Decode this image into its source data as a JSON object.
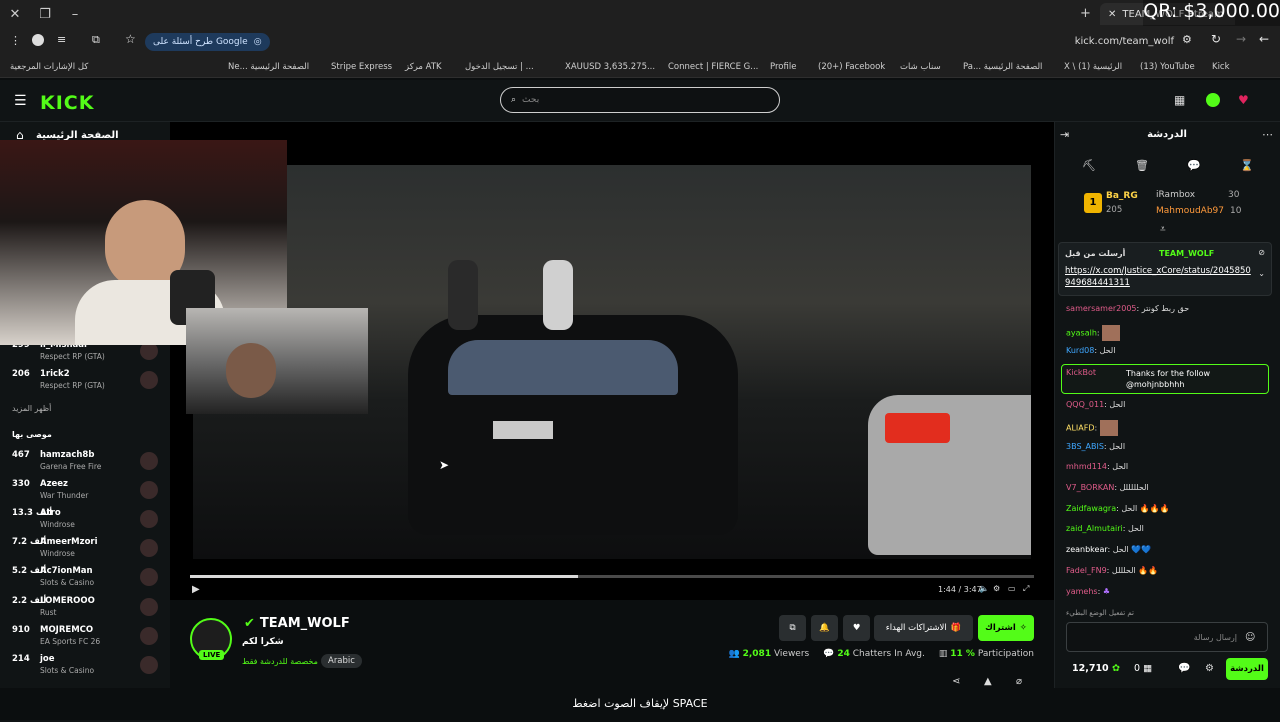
{
  "browser": {
    "tab_title": "TEAM_WOLF Stream",
    "overlay_text": "QR: $3,000.00",
    "google_button": "طرح أسئلة على Google",
    "url": "kick.com/team_wolf",
    "bookmarks": [
      "كل الإشارات المرجعية",
      "Ne... الصفحة الرئيسية",
      "Stripe Express",
      "مركز ATK",
      "تسجيل الدخول | ...",
      "XAUUSD 3,635.275...",
      "Connect | FIERCE G...",
      "Profile",
      "(20+) Facebook",
      "سناب شات",
      "Pa... الصفحة الرئيسية",
      "X \\ (1) الرئيسية",
      "(13) YouTube",
      "Kick"
    ]
  },
  "site": {
    "logo": "KICK",
    "search_placeholder": "بحث",
    "home_label": "الصفحة الرئيسية"
  },
  "sidebar": {
    "top_items": [
      {
        "count": "299",
        "name": "ii_Mishaal",
        "game": "Respect RP (GTA)"
      },
      {
        "count": "206",
        "name": "1rick2",
        "game": "Respect RP (GTA)"
      }
    ],
    "show_more": "أظهر المزيد",
    "recommended_label": "موصى بها",
    "recommended": [
      {
        "count": "467",
        "name": "hamzach8b",
        "game": "Garena Free Fire"
      },
      {
        "count": "330",
        "name": "Azeez",
        "game": "War Thunder"
      },
      {
        "count": "13.3 ألف",
        "name": "Atro",
        "game": "Windrose"
      },
      {
        "count": "7.2 ألف",
        "name": "AmeerMzori",
        "game": "Windrose"
      },
      {
        "count": "5.2 ألف",
        "name": "Ac7ionMan",
        "game": "Slots & Casino"
      },
      {
        "count": "2.2 ألف",
        "name": "LOMEROOO",
        "game": "Rust"
      },
      {
        "count": "910",
        "name": "MOJREMCO",
        "game": "EA Sports FC 26"
      },
      {
        "count": "214",
        "name": "joe",
        "game": "Slots & Casino"
      }
    ]
  },
  "player": {
    "time": "1:44 / 3:47",
    "progress": 0.46
  },
  "channel": {
    "name": "TEAM_WOLF",
    "live": "LIVE",
    "title": "شكرا لكم",
    "category": "مخصصة للدردشة فقط",
    "language": "Arabic",
    "subscribe": "اشتراك",
    "gift_subs": "الاشتراكات الهداء",
    "viewers": "2,081",
    "viewers_label": "Viewers",
    "chatters": "24",
    "chatters_label": "Chatters In Avg.",
    "participation": "11 %",
    "participation_label": "Participation"
  },
  "chat": {
    "title": "الدردشة",
    "leaderboard": [
      {
        "rank": "1",
        "name": "Ba_RG",
        "value": "205"
      },
      {
        "name": "iRambox",
        "value": "30"
      },
      {
        "name": "MahmoudAb97",
        "value": "10"
      }
    ],
    "pinned_by": "أرسلت من قبل",
    "pinned_user": "TEAM_WOLF",
    "pinned_link": "https://x.com/Justice_xCore/status/2045850949684441311",
    "messages": [
      {
        "user": "samersamer2005",
        "text": "حق ربط كونتر",
        "color": "#e05c8a"
      },
      {
        "user": "ayasalh",
        "text": "",
        "color": "#53fc18"
      },
      {
        "user": "Kurd08",
        "text": "الحل",
        "color": "#3fa7ff"
      },
      {
        "user": "KickBot",
        "text": "Thanks for the follow @mohjnbbhhh",
        "color": "#e05c8a"
      },
      {
        "user": "QQQ_011",
        "text": "الحل",
        "color": "#e05c8a"
      },
      {
        "user": "ALIAFD",
        "text": "",
        "color": "#ffe066"
      },
      {
        "user": "3BS_ABIS",
        "text": "الحل",
        "color": "#3fa7ff"
      },
      {
        "user": "mhmd114",
        "text": "الحل",
        "color": "#e05c8a"
      },
      {
        "user": "V7_BORKAN",
        "text": "الحلللللل",
        "color": "#e05c8a"
      },
      {
        "user": "Zaidfawagra",
        "text": "الحل 🔥🔥🔥",
        "color": "#53fc18"
      },
      {
        "user": "zaid_Almutairi",
        "text": "الحل",
        "color": "#53fc18"
      },
      {
        "user": "zeanbkear",
        "text": "الحل 💙💙",
        "color": "#ffffff"
      },
      {
        "user": "Fadel_FN9",
        "text": "الحلللل 🔥🔥",
        "color": "#e05c8a"
      },
      {
        "user": "yamehs",
        "text": "",
        "color": "#e05c8a"
      }
    ],
    "slow_mode_note": "تم تفعيل الوضع البطيء",
    "input_placeholder": "إرسال رسالة",
    "points": "12,710",
    "zero": "0",
    "send": "الدردشة"
  },
  "caption": "لإيقاف الصوت اضغط SPACE"
}
